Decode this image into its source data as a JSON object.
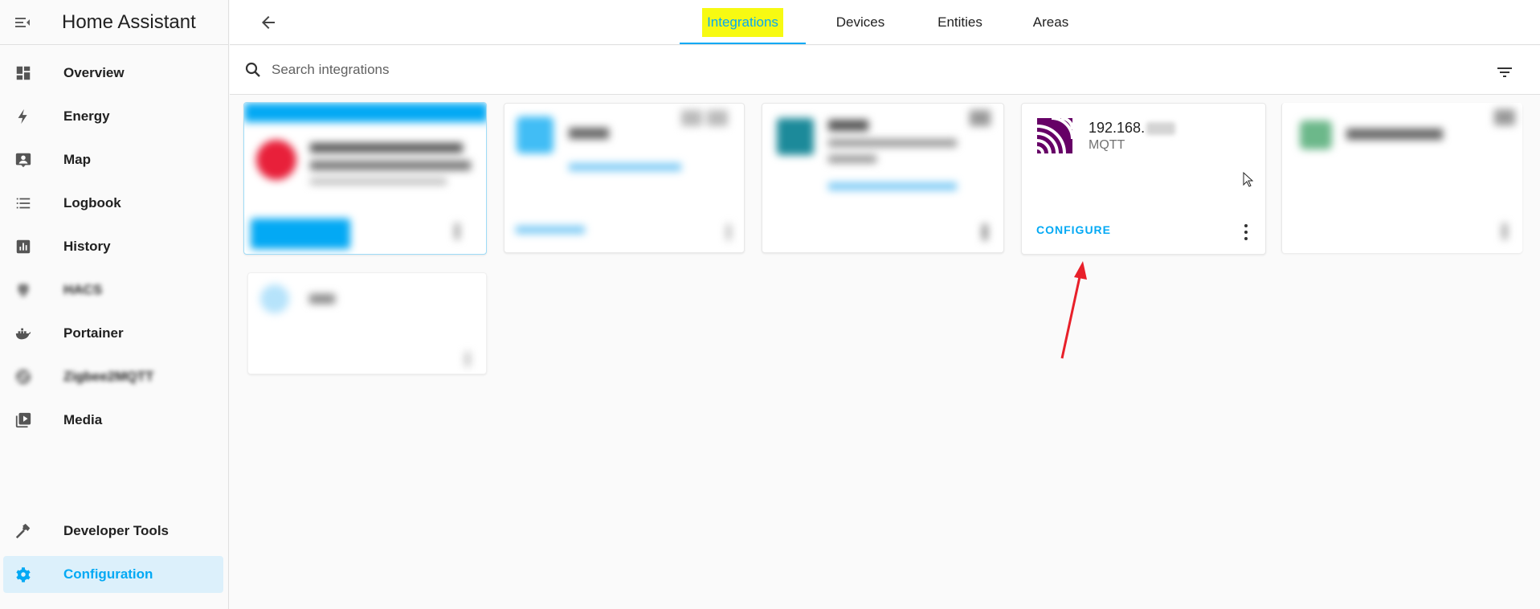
{
  "app": {
    "title": "Home Assistant"
  },
  "sidebar": {
    "items": [
      {
        "label": "Overview",
        "icon": "dashboard-icon"
      },
      {
        "label": "Energy",
        "icon": "lightning-icon"
      },
      {
        "label": "Map",
        "icon": "map-account-icon"
      },
      {
        "label": "Logbook",
        "icon": "list-icon"
      },
      {
        "label": "History",
        "icon": "chart-box-icon"
      },
      {
        "label": "HACS",
        "icon": "hacs-icon"
      },
      {
        "label": "Portainer",
        "icon": "docker-icon"
      },
      {
        "label": "Zigbee2MQTT",
        "icon": "zigbee-icon"
      },
      {
        "label": "Media",
        "icon": "play-box-icon"
      }
    ],
    "bottom_items": [
      {
        "label": "Developer Tools",
        "icon": "hammer-icon"
      },
      {
        "label": "Configuration",
        "icon": "gear-icon"
      }
    ]
  },
  "tabs": [
    {
      "label": "Integrations",
      "active": true
    },
    {
      "label": "Devices",
      "active": false
    },
    {
      "label": "Entities",
      "active": false
    },
    {
      "label": "Areas",
      "active": false
    }
  ],
  "search": {
    "placeholder": "Search integrations"
  },
  "mqtt_card": {
    "host": "192.168.",
    "name": "MQTT",
    "configure_label": "CONFIGURE"
  },
  "colors": {
    "accent": "#03a9f4",
    "highlight": "#f7fa12",
    "mqtt_purple": "#660066",
    "annotation_arrow": "#e8202a"
  }
}
